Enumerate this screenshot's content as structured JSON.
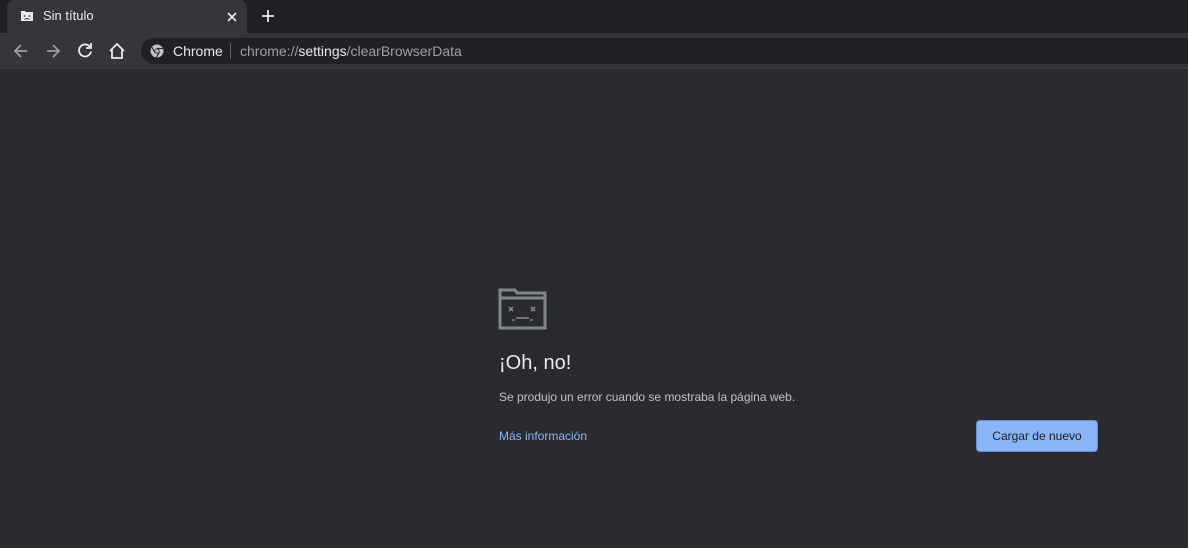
{
  "tab": {
    "title": "Sin título",
    "favicon": "sad-tab-icon"
  },
  "toolbar": {
    "back_icon": "arrow-left-icon",
    "forward_icon": "arrow-right-icon",
    "reload_icon": "reload-icon",
    "home_icon": "home-icon"
  },
  "omnibox": {
    "site_chip": "Chrome",
    "url_scheme": "chrome://",
    "url_host": "settings",
    "url_path": "/clearBrowserData"
  },
  "error": {
    "title": "¡Oh, no!",
    "description": "Se produjo un error cuando se mostraba la página web.",
    "more_info_link": "Más información",
    "reload_button": "Cargar de nuevo"
  },
  "colors": {
    "accent": "#8ab4f8",
    "background": "#2a2b2f",
    "toolbar": "#35363a",
    "tabstrip": "#202124"
  }
}
